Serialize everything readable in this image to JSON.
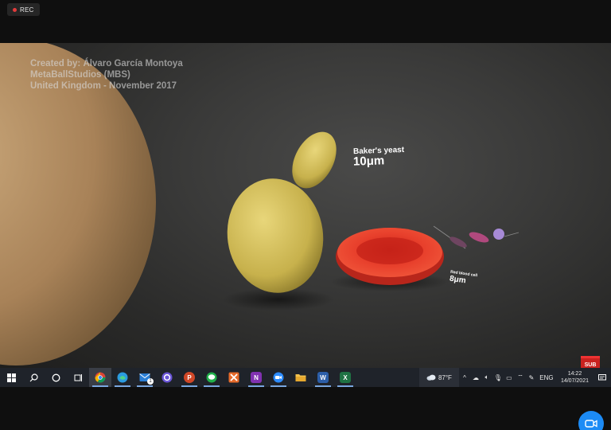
{
  "recording": {
    "label": "REC"
  },
  "video": {
    "credit_lines": [
      "Created by: Álvaro García Montoya",
      "MetaBallStudios (MBS)",
      "United Kingdom - November 2017"
    ],
    "labels": {
      "yeast_name": "Baker's yeast",
      "yeast_size": "10μm",
      "rbc_name": "Red blood cell",
      "rbc_size": "8μm"
    },
    "badge": "SUB"
  },
  "taskbar": {
    "apps": [
      {
        "name": "windows-start-icon",
        "color": "#ffffff"
      },
      {
        "name": "search-icon",
        "color": "#ffffff"
      },
      {
        "name": "cortana-icon",
        "color": "#ffffff"
      },
      {
        "name": "task-view-icon",
        "color": "#ffffff"
      },
      {
        "name": "chrome-icon",
        "color": "#e8a33a",
        "active": true
      },
      {
        "name": "edge-icon",
        "color": "#2b9be0"
      },
      {
        "name": "mail-icon",
        "color": "#2b7fd6",
        "badge": "1"
      },
      {
        "name": "cortana-app-icon",
        "color": "#6b56d8"
      },
      {
        "name": "powerpoint-icon",
        "color": "#d04727",
        "letter": "P"
      },
      {
        "name": "line-icon",
        "color": "#21b04b"
      },
      {
        "name": "xmind-icon",
        "color": "#e56a2a"
      },
      {
        "name": "onenote-icon",
        "color": "#8132b1",
        "letter": "N"
      },
      {
        "name": "zoom-icon",
        "color": "#2d8cff"
      },
      {
        "name": "file-explorer-icon",
        "color": "#f2c14e"
      },
      {
        "name": "word-icon",
        "color": "#2c5ea8",
        "letter": "W"
      },
      {
        "name": "excel-icon",
        "color": "#1f7244",
        "letter": "X"
      }
    ],
    "weather": {
      "temp": "87°F"
    },
    "language": "ENG",
    "time": "14:22",
    "date": "14/07/2021"
  }
}
